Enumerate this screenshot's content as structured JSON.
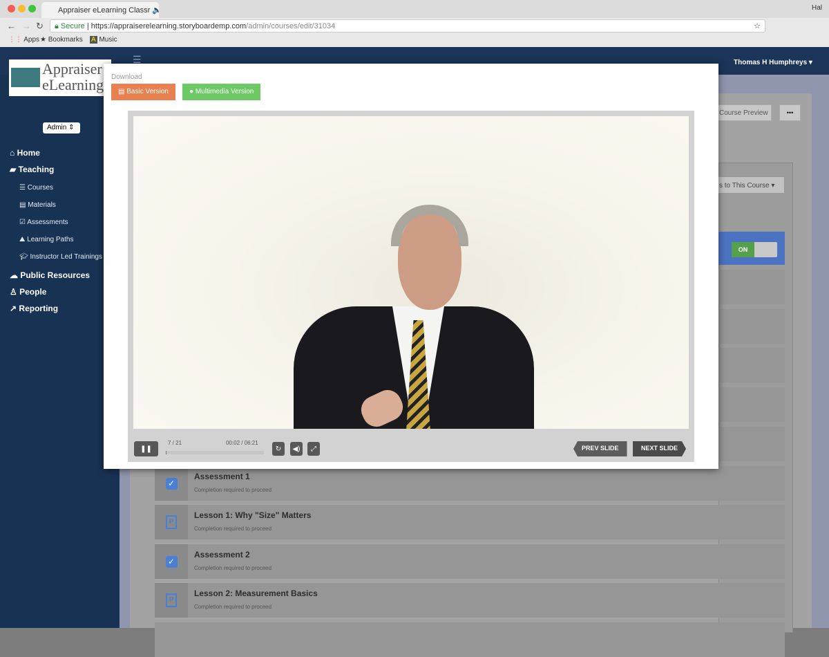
{
  "browser": {
    "tab_title": "Appraiser eLearning Classr",
    "secure_label": "Secure",
    "url_host": "https://appraiserelearning.storyboardemp.com",
    "url_path": "/admin/courses/edit/31034",
    "bookmarks": [
      "Apps",
      "Bookmarks",
      "Music"
    ],
    "profile": "Hal"
  },
  "header": {
    "user_name": "Thomas H Humphreys"
  },
  "logo": {
    "line1": "Appraiser",
    "line2": "eLearning"
  },
  "sidebar": {
    "role_select": "Admin",
    "items": [
      {
        "label": "Home",
        "icon": "home-icon"
      },
      {
        "label": "Teaching",
        "icon": "book-icon"
      },
      {
        "label": "Courses",
        "icon": "list-icon",
        "sub": true
      },
      {
        "label": "Materials",
        "icon": "file-icon",
        "sub": true
      },
      {
        "label": "Assessments",
        "icon": "checkbox-icon",
        "sub": true
      },
      {
        "label": "Learning Paths",
        "icon": "road-icon",
        "sub": true
      },
      {
        "label": "Instructor Led Trainings",
        "icon": "graduation-cap-icon",
        "sub": true
      },
      {
        "label": "Public Resources",
        "icon": "cloud-icon"
      },
      {
        "label": "People",
        "icon": "person-icon"
      },
      {
        "label": "Reporting",
        "icon": "chart-icon"
      }
    ]
  },
  "page": {
    "course_preview": "Course Preview",
    "more": "•••",
    "assign_dropdown": "s to This Course",
    "toggle": "ON"
  },
  "modal": {
    "download_label": "Download",
    "basic_version": "Basic Version",
    "multimedia_version": "Multimedia Version",
    "player": {
      "slide_counter": "7 / 21",
      "time": "00:02 / 06:21",
      "progress": 0.005,
      "prev": "PREV SLIDE",
      "next": "NEXT SLIDE"
    }
  },
  "course_items": [
    {
      "title": "Assessment 1",
      "subtitle": "Completion required to proceed",
      "type": "assessment"
    },
    {
      "title": "Lesson 1: Why \"Size\" Matters",
      "subtitle": "Completion required to proceed",
      "type": "lesson"
    },
    {
      "title": "Assessment 2",
      "subtitle": "Completion required to proceed",
      "type": "assessment"
    },
    {
      "title": "Lesson 2: Measurement Basics",
      "subtitle": "Completion required to proceed",
      "type": "lesson"
    }
  ],
  "colors": {
    "nav": "#1b3458",
    "basic": "#e8814f",
    "multimedia": "#6cc964",
    "check": "#4a7fd6"
  }
}
